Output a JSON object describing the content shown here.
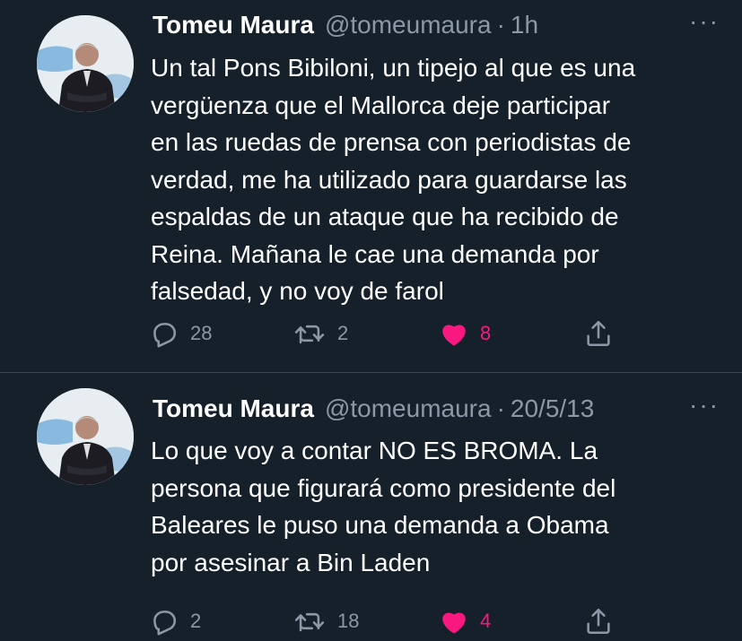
{
  "tweets": [
    {
      "name": "Tomeu Maura",
      "handle": "@tomeumaura",
      "separator": "·",
      "time": "1h",
      "more": "···",
      "text": "Un tal Pons Bibiloni, un tipejo al que es una\nvergüenza que el Mallorca deje participar\nen las ruedas de prensa con periodistas de\nverdad, me ha utilizado para guardarse las\nespaldas de un ataque que ha recibido de\nReina. Mañana le cae una demanda por\nfalsedad, y no voy de farol",
      "replies": "28",
      "retweets": "2",
      "likes": "8",
      "liked": true
    },
    {
      "name": "Tomeu Maura",
      "handle": "@tomeumaura",
      "separator": "·",
      "time": "20/5/13",
      "more": "···",
      "text": "Lo que voy a contar NO ES BROMA. La\npersona que figurará como presidente del\nBaleares le puso una demanda a Obama\npor asesinar a Bin Laden",
      "replies": "2",
      "retweets": "18",
      "likes": "4",
      "liked": true
    }
  ],
  "colors": {
    "background": "#15202b",
    "text": "#ffffff",
    "secondary": "#8b98a5",
    "like": "#f91880",
    "divider": "#38444d"
  },
  "icons": {
    "reply": "reply-icon",
    "retweet": "retweet-icon",
    "like": "heart-icon",
    "share": "share-icon",
    "more": "more-icon"
  }
}
